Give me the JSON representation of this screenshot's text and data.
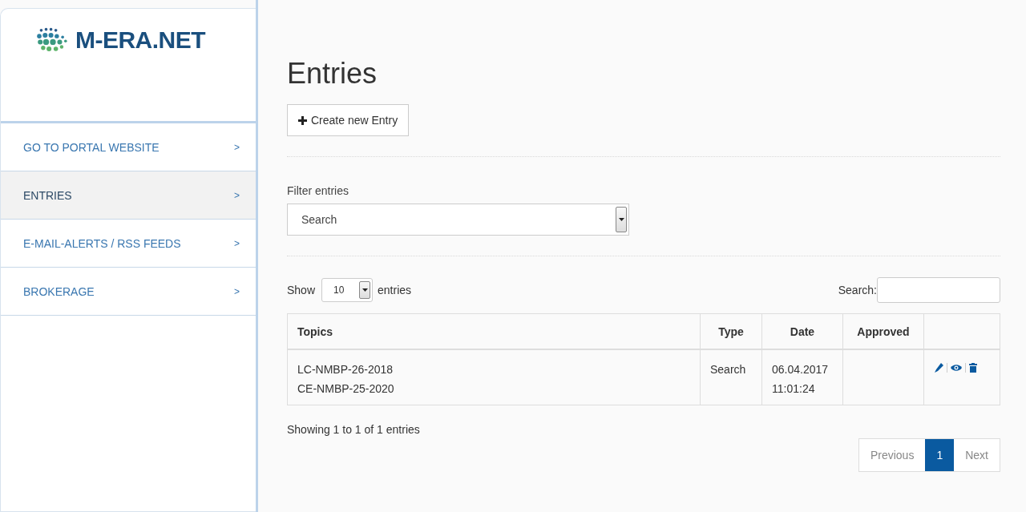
{
  "logo": {
    "text": "M-ERA.NET"
  },
  "sidebar": {
    "items": [
      {
        "label": "GO TO PORTAL WEBSITE",
        "chevron": ">",
        "selected": false
      },
      {
        "label": "ENTRIES",
        "chevron": ">",
        "selected": true
      },
      {
        "label": "E-MAIL-ALERTS / RSS FEEDS",
        "chevron": ">",
        "selected": false
      },
      {
        "label": "BROKERAGE",
        "chevron": ">",
        "selected": false
      }
    ]
  },
  "page": {
    "title": "Entries",
    "create_button": "Create new Entry",
    "filter_label": "Filter entries",
    "filter_value": "Search"
  },
  "table_controls": {
    "show_label": "Show",
    "page_size": "10",
    "entries_label": "entries",
    "search_label": "Search:"
  },
  "table": {
    "columns": [
      "Topics",
      "Type",
      "Date",
      "Approved"
    ],
    "rows": [
      {
        "topics": [
          "LC-NMBP-26-2018",
          "CE-NMBP-25-2020"
        ],
        "type": "Search",
        "date": [
          "06.04.2017",
          "11:01:24"
        ]
      }
    ]
  },
  "footer": {
    "info": "Showing 1 to 1 of 1 entries",
    "pages": [
      {
        "label": "Previous",
        "selected": false
      },
      {
        "label": "1",
        "selected": true
      },
      {
        "label": "Next",
        "selected": false
      }
    ]
  }
}
